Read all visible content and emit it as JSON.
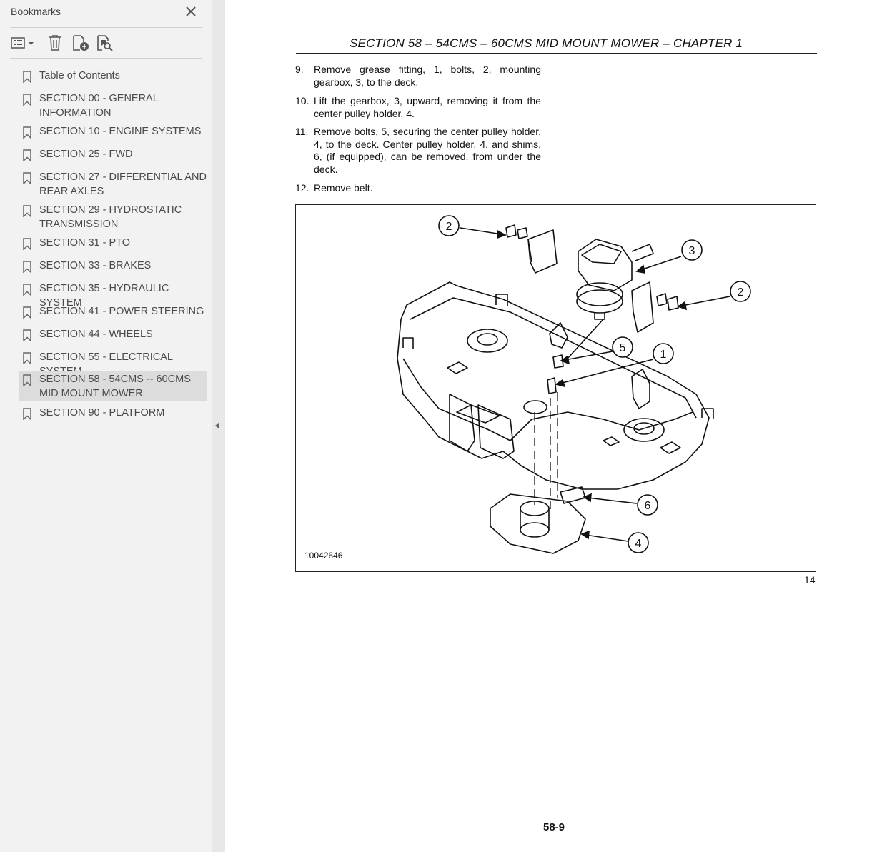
{
  "sidebar": {
    "title": "Bookmarks",
    "bookmarks": [
      {
        "label": "Table of Contents"
      },
      {
        "label": "SECTION 00 - GENERAL INFORMATION"
      },
      {
        "label": "SECTION 10 - ENGINE SYSTEMS"
      },
      {
        "label": "SECTION 25 - FWD"
      },
      {
        "label": "SECTION 27 - DIFFERENTIAL AND REAR AXLES"
      },
      {
        "label": "SECTION 29 - HYDROSTATIC TRANSMISSION"
      },
      {
        "label": "SECTION 31 - PTO"
      },
      {
        "label": "SECTION 33 - BRAKES"
      },
      {
        "label": "SECTION 35 - HYDRAULIC SYSTEM"
      },
      {
        "label": "SECTION 41 - POWER STEERING"
      },
      {
        "label": "SECTION 44 - WHEELS"
      },
      {
        "label": "SECTION 55 - ELECTRICAL SYSTEM"
      },
      {
        "label": "SECTION 58 - 54CMS -- 60CMS MID MOUNT MOWER",
        "selected": true
      },
      {
        "label": "SECTION 90 - PLATFORM"
      }
    ],
    "icons": [
      "options-menu-icon",
      "delete-icon",
      "add-bookmark-icon",
      "find-bookmark-icon",
      "close-icon"
    ]
  },
  "document": {
    "header": "SECTION 58 – 54CMS – 60CMS MID MOUNT MOWER – CHAPTER 1",
    "steps": [
      {
        "num": "9.",
        "text": "Remove grease fitting, 1, bolts, 2, mounting gearbox, 3, to the deck."
      },
      {
        "num": "10.",
        "text": "Lift the gearbox, 3, upward, removing it from the center pulley holder, 4."
      },
      {
        "num": "11.",
        "text": "Remove bolts, 5, securing the center pulley holder, 4, to the deck. Center pulley holder, 4, and shims, 6, (if equipped), can be removed, from under the deck."
      },
      {
        "num": "12.",
        "text": "Remove belt."
      }
    ],
    "figure": {
      "id": "10042646",
      "callouts": [
        "2",
        "3",
        "2",
        "5",
        "1",
        "6",
        "4"
      ],
      "number": "14"
    },
    "page_footer": "58-9"
  }
}
